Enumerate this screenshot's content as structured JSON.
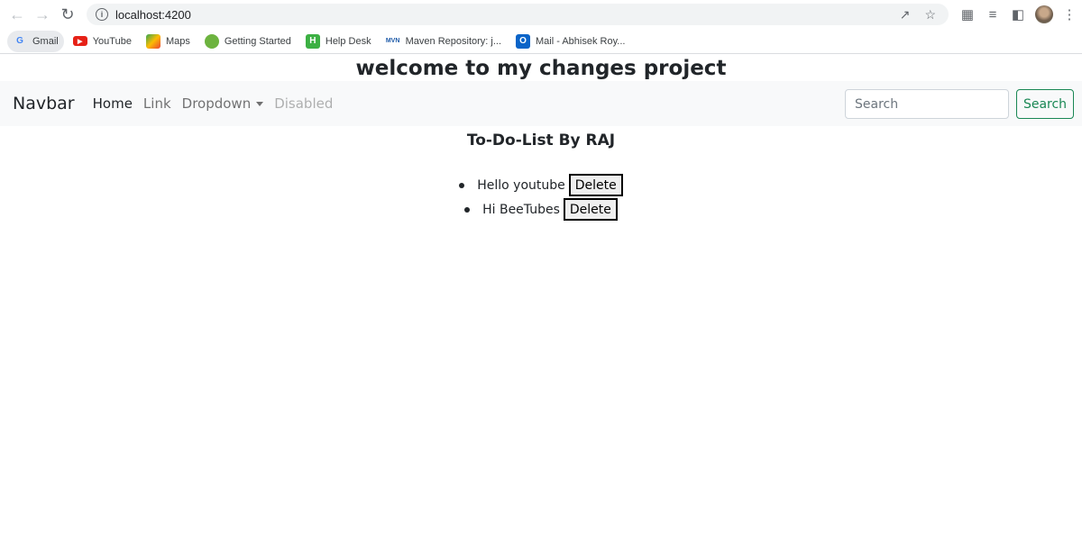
{
  "browser": {
    "url": "localhost:4200",
    "bookmarks": [
      {
        "label": "Gmail",
        "icon": "google-icon"
      },
      {
        "label": "YouTube",
        "icon": "youtube-icon"
      },
      {
        "label": "Maps",
        "icon": "maps-icon"
      },
      {
        "label": "Getting Started",
        "icon": "spring-icon"
      },
      {
        "label": "Help Desk",
        "icon": "helpdesk-icon"
      },
      {
        "label": "Maven Repository: j...",
        "icon": "maven-icon"
      },
      {
        "label": "Mail - Abhisek Roy...",
        "icon": "outlook-icon"
      }
    ]
  },
  "page": {
    "title": "welcome to my changes project",
    "navbar": {
      "brand": "Navbar",
      "links": [
        "Home",
        "Link",
        "Dropdown",
        "Disabled"
      ],
      "search_placeholder": "Search",
      "search_button": "Search"
    },
    "todo": {
      "heading": "To-Do-List By RAJ",
      "items": [
        {
          "text": "Hello youtube",
          "action": "Delete"
        },
        {
          "text": "Hi BeeTubes",
          "action": "Delete"
        }
      ]
    }
  },
  "colors": {
    "navbar_bg": "#f8f9fa",
    "success": "#198754"
  }
}
